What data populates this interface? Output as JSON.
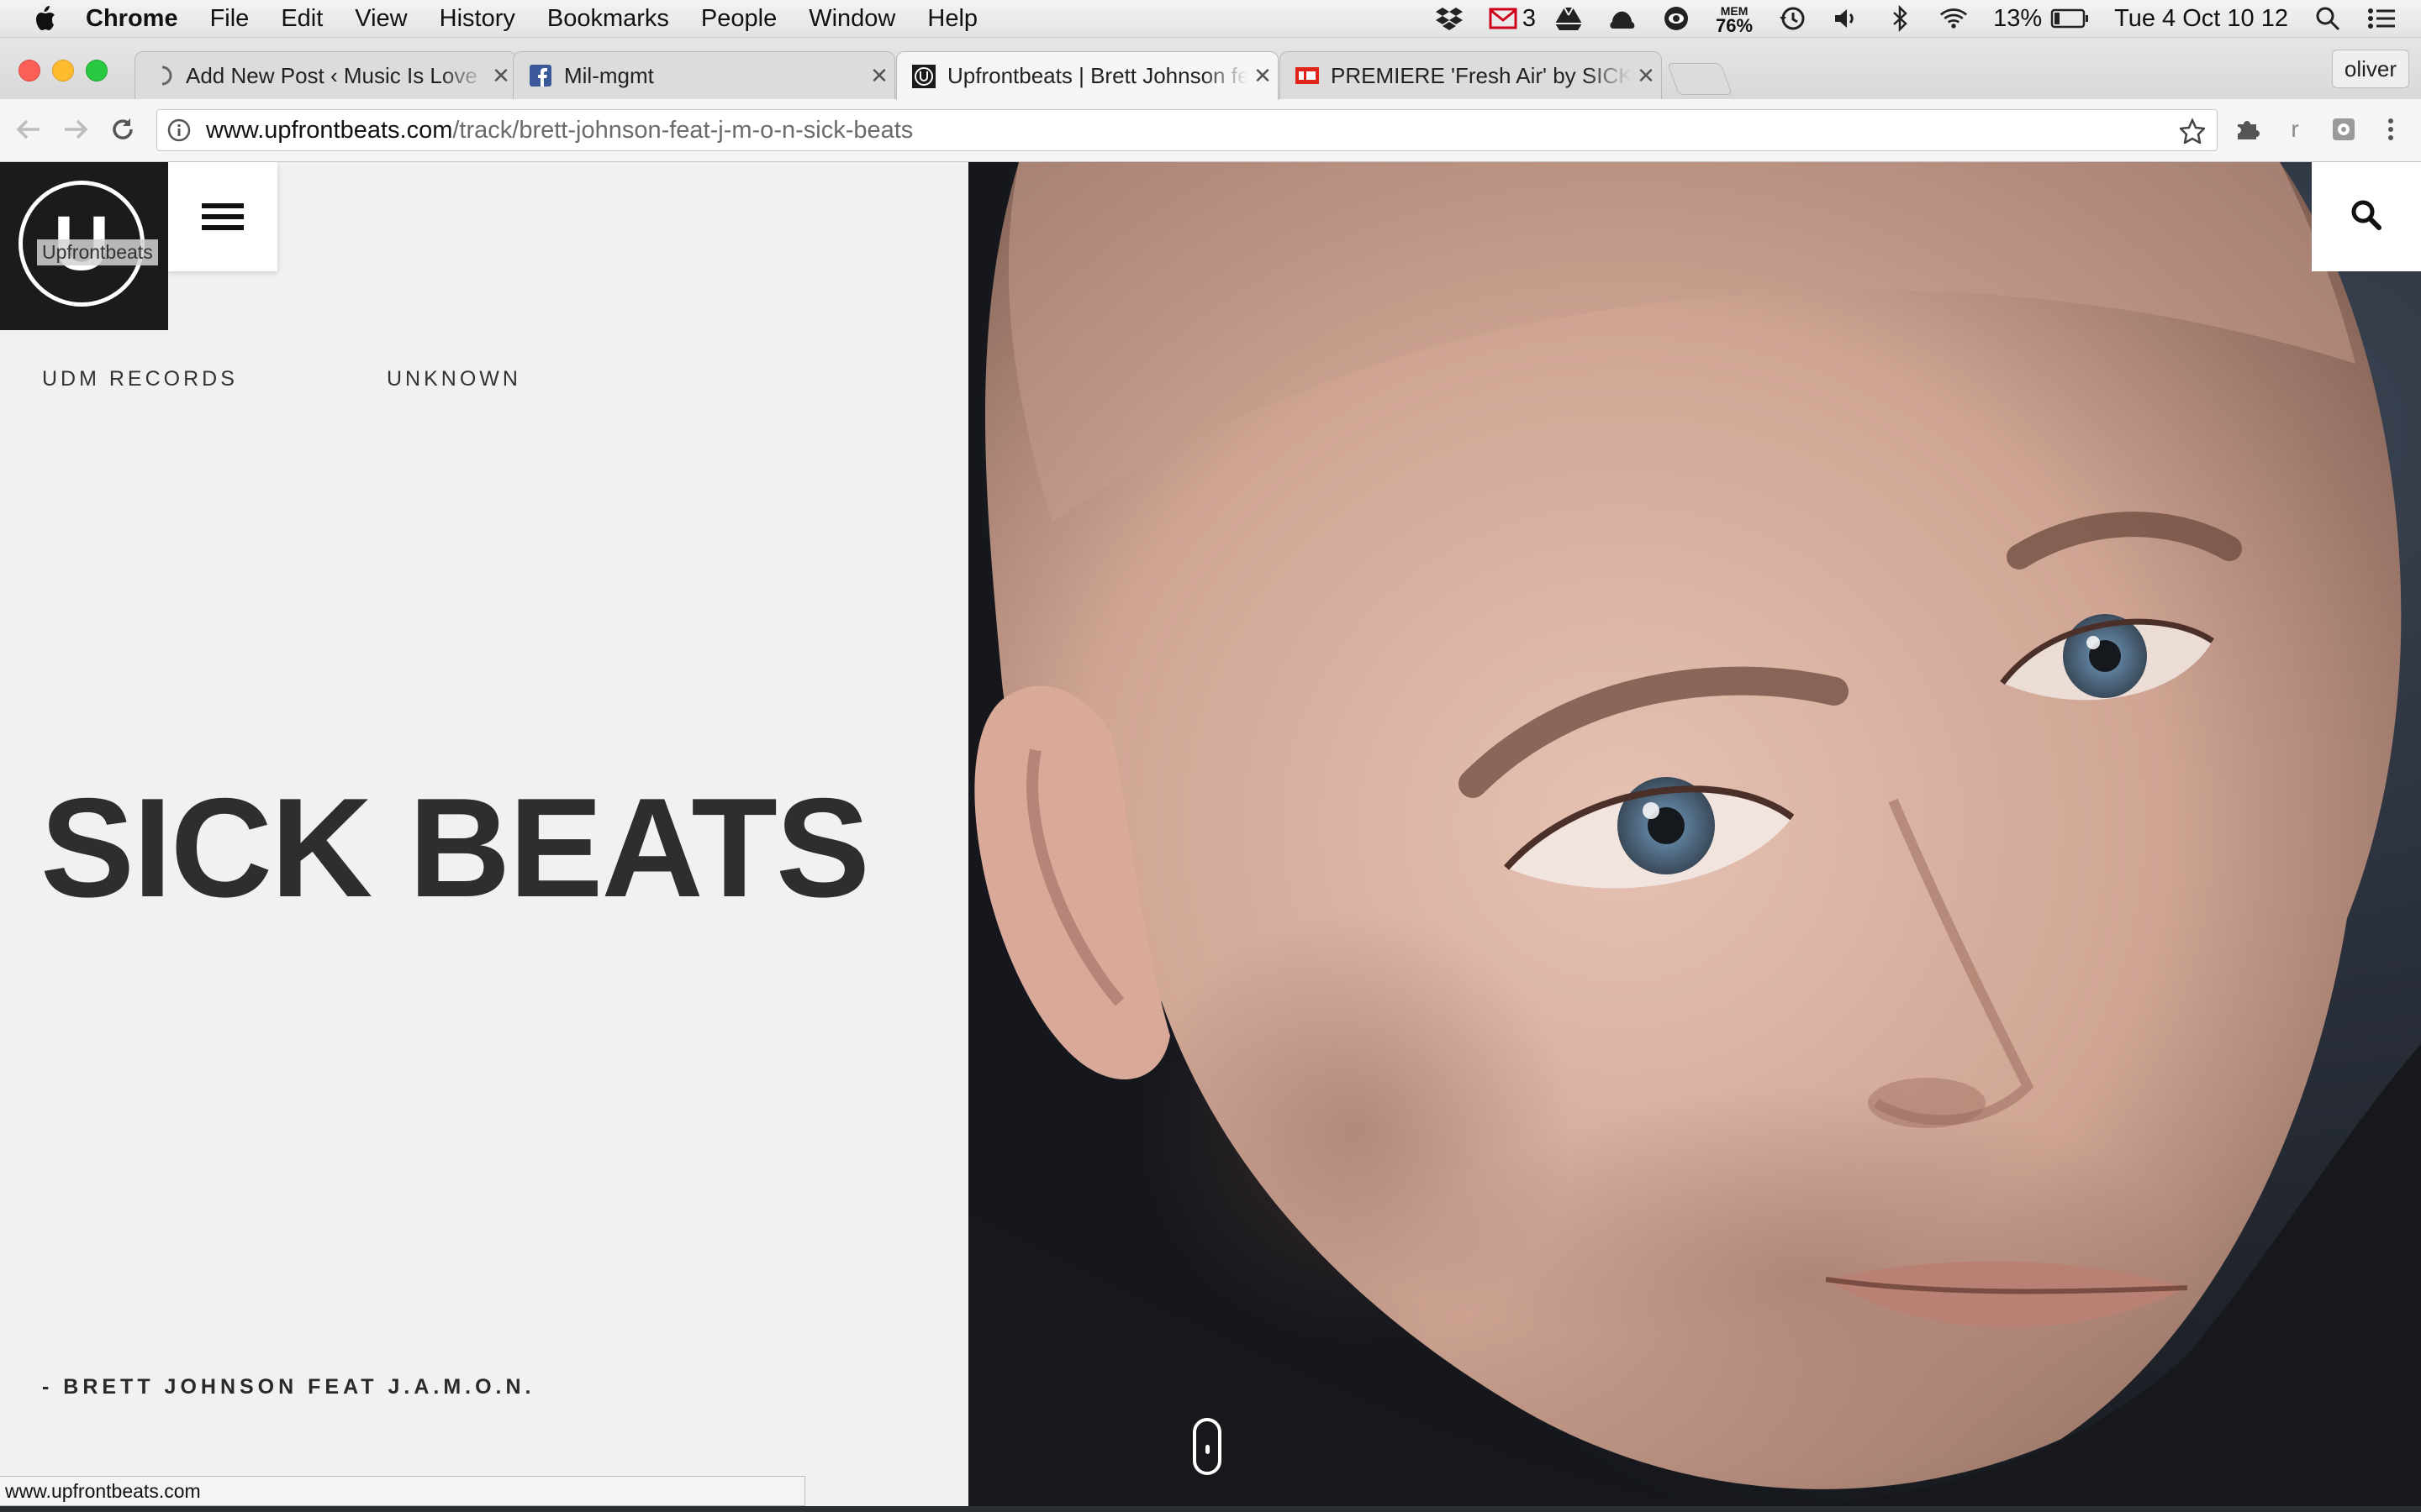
{
  "menubar": {
    "app_name": "Chrome",
    "items": [
      "File",
      "Edit",
      "View",
      "History",
      "Bookmarks",
      "People",
      "Window",
      "Help"
    ],
    "status": {
      "mail_count": "3",
      "mem_label": "MEM",
      "mem_value": "76%",
      "battery": "13%",
      "clock": "Tue 4 Oct  10 12"
    }
  },
  "browser": {
    "tabs": [
      {
        "title": "Add New Post ‹ Music Is Love",
        "active": false
      },
      {
        "title": "Mil-mgmt",
        "active": false
      },
      {
        "title": "Upfrontbeats | Brett Johnson feat",
        "active": true
      },
      {
        "title": "PREMIERE 'Fresh Air' by SICK",
        "active": false
      }
    ],
    "profile_name": "oliver",
    "url_host": "www.upfrontbeats.com",
    "url_path": "/track/brett-johnson-feat-j-m-o-n-sick-beats",
    "toolbar_letter": "r",
    "status_url": "www.upfrontbeats.com"
  },
  "page": {
    "logo_letter": "U",
    "logo_tooltip": "Upfrontbeats",
    "label": "UDM RECORDS",
    "genre": "UNKNOWN",
    "track_title": "SICK BEATS",
    "artist_line": "- BRETT JOHNSON FEAT J.A.M.O.N."
  },
  "colors": {
    "left_panel_bg": "#f1f1f1",
    "logo_bg": "#1b1b1b",
    "title_text": "#2e2e2e",
    "mail_icon": "#d0021b"
  }
}
